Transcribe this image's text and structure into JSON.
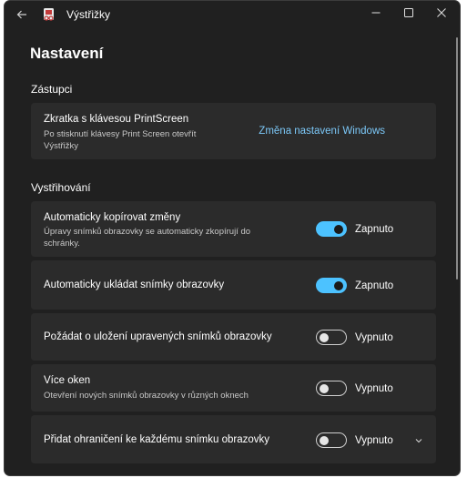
{
  "window": {
    "title": "Výstřižky"
  },
  "page": {
    "heading": "Nastavení"
  },
  "sections": {
    "shortcuts": {
      "label": "Zástupci",
      "printscreen": {
        "title": "Zkratka s klávesou PrintScreen",
        "description": "Po stisknutí klávesy Print Screen otevřít Výstřižky",
        "link": "Změna nastavení Windows"
      }
    },
    "snipping": {
      "label": "Vystřihování",
      "items": [
        {
          "title": "Automaticky kopírovat změny",
          "description": "Úpravy snímků obrazovky se automaticky zkopírují do schránky.",
          "state": "Zapnuto",
          "on": true
        },
        {
          "title": "Automaticky ukládat snímky obrazovky",
          "description": "",
          "state": "Zapnuto",
          "on": true
        },
        {
          "title": "Požádat o uložení upravených snímků obrazovky",
          "description": "",
          "state": "Vypnuto",
          "on": false
        },
        {
          "title": "Více oken",
          "description": "Otevření nových snímků obrazovky v různých oknech",
          "state": "Vypnuto",
          "on": false
        },
        {
          "title": "Přidat ohraničení ke každému snímku obrazovky",
          "description": "",
          "state": "Vypnuto",
          "on": false,
          "expandable": true
        }
      ]
    }
  },
  "colors": {
    "accent": "#4cc2ff",
    "link": "#7cc8f8",
    "background": "#202020",
    "card": "#2b2b2b"
  }
}
